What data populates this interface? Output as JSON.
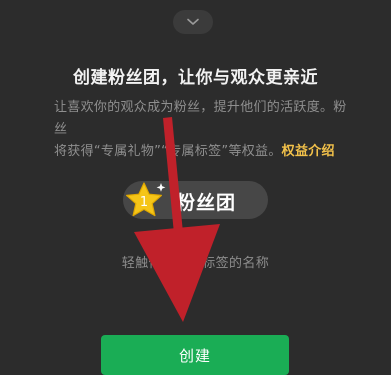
{
  "colors": {
    "background": "#2c2c2c",
    "accent_link": "#f2c14a",
    "primary_button": "#1aad55",
    "annotation_arrow": "#c0212a"
  },
  "header": {
    "collapse_icon": "chevron-down-icon"
  },
  "title": "创建粉丝团，让你与观众更亲近",
  "description": {
    "line1": "让喜欢你的观众成为粉丝，提升他们的活跃度。粉丝",
    "line2": "将获得“专属礼物”“专属标签”等权益。",
    "link": "权益介绍"
  },
  "badge": {
    "level": "1",
    "icon": "star-icon",
    "name": "粉丝团"
  },
  "hint": "轻触修改粉丝标签的名称",
  "actions": {
    "create_label": "创建"
  },
  "annotation": {
    "icon": "red-arrow-down"
  }
}
